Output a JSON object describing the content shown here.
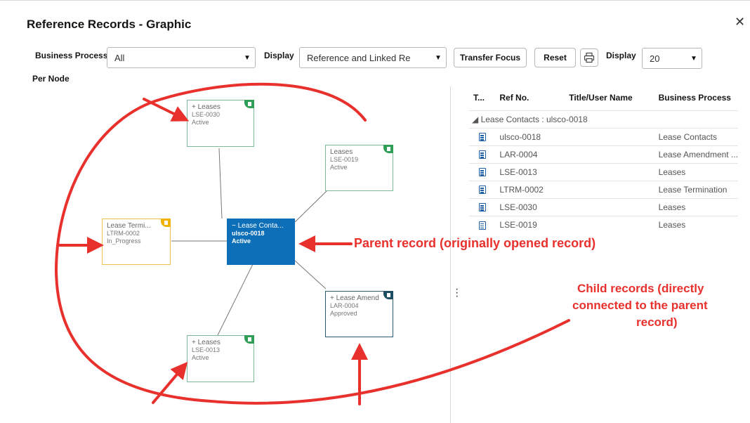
{
  "dialog": {
    "title": "Reference Records - Graphic",
    "close_icon": "close-icon"
  },
  "toolbar": {
    "business_process_label": "Business Process",
    "business_process_value": "All",
    "display_label": "Display",
    "display_value": "Reference and Linked Re",
    "transfer_focus_label": "Transfer Focus",
    "reset_label": "Reset",
    "print_icon": "print-icon",
    "display_count_label": "Display",
    "display_count_value": "20",
    "per_node_label": "Per Node"
  },
  "graph": {
    "center": {
      "title": "Lease Conta...",
      "ref": "ulsco-0018",
      "status": "Active",
      "toggle": "−"
    },
    "nodes": [
      {
        "id": "lse0030",
        "toggle": "+",
        "title": "Leases",
        "ref": "LSE-0030",
        "status": "Active"
      },
      {
        "id": "lse0019",
        "toggle": "",
        "title": "Leases",
        "ref": "LSE-0019",
        "status": "Active"
      },
      {
        "id": "ltrm0002",
        "toggle": "",
        "title": "Lease Termi...",
        "ref": "LTRM-0002",
        "status": "In_Progress"
      },
      {
        "id": "lar0004",
        "toggle": "+",
        "title": "Lease Amend",
        "ref": "LAR-0004",
        "status": "Approved"
      },
      {
        "id": "lse0013",
        "toggle": "+",
        "title": "Leases",
        "ref": "LSE-0013",
        "status": "Active"
      }
    ]
  },
  "table": {
    "headers": [
      "T...",
      "Ref No.",
      "Title/User Name",
      "Business Process"
    ],
    "group": "◢ Lease Contacts : ulsco-0018",
    "rows": [
      {
        "ref": "ulsco-0018",
        "title": "",
        "process": "Lease Contacts"
      },
      {
        "ref": "LAR-0004",
        "title": "",
        "process": "Lease Amendment ..."
      },
      {
        "ref": "LSE-0013",
        "title": "",
        "process": "Leases"
      },
      {
        "ref": "LTRM-0002",
        "title": "",
        "process": "Lease Termination"
      },
      {
        "ref": "LSE-0030",
        "title": "",
        "process": "Leases"
      },
      {
        "ref": "LSE-0019",
        "title": "",
        "process": "Leases"
      }
    ]
  },
  "annotations": {
    "parent": "Parent record (originally opened record)",
    "child_line1": "Child records (directly",
    "child_line2": "connected to the parent",
    "child_line3": "record)",
    "color": "#e8312d"
  },
  "colors": {
    "accent_blue": "#0d6fb8",
    "node_green": "#2f9e56",
    "node_yellow": "#f0b400",
    "node_teal": "#1e4e62"
  }
}
